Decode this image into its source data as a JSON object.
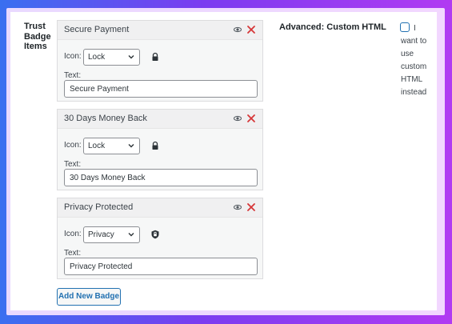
{
  "section": {
    "label": "Trust Badge Items"
  },
  "badges": [
    {
      "title": "Secure Payment",
      "icon_label": "Icon:",
      "icon_value": "Lock",
      "icon_glyph": "lock-icon",
      "text_label": "Text:",
      "text_value": "Secure Payment"
    },
    {
      "title": "30 Days Money Back",
      "icon_label": "Icon:",
      "icon_value": "Lock",
      "icon_glyph": "lock-icon",
      "text_label": "Text:",
      "text_value": "30 Days Money Back"
    },
    {
      "title": "Privacy Protected",
      "icon_label": "Icon:",
      "icon_value": "Privacy",
      "icon_glyph": "shield-lock-icon",
      "text_label": "Text:",
      "text_value": "Privacy Protected"
    }
  ],
  "add_button": {
    "label": "Add New Badge"
  },
  "advanced": {
    "label": "Advanced: Custom HTML",
    "checkbox_label": "I want to use custom HTML instead",
    "checked": false
  },
  "colors": {
    "accent": "#2271b1",
    "close": "#d63638",
    "gradient_left": "#3a6ff0",
    "gradient_right": "#b13bf2"
  }
}
